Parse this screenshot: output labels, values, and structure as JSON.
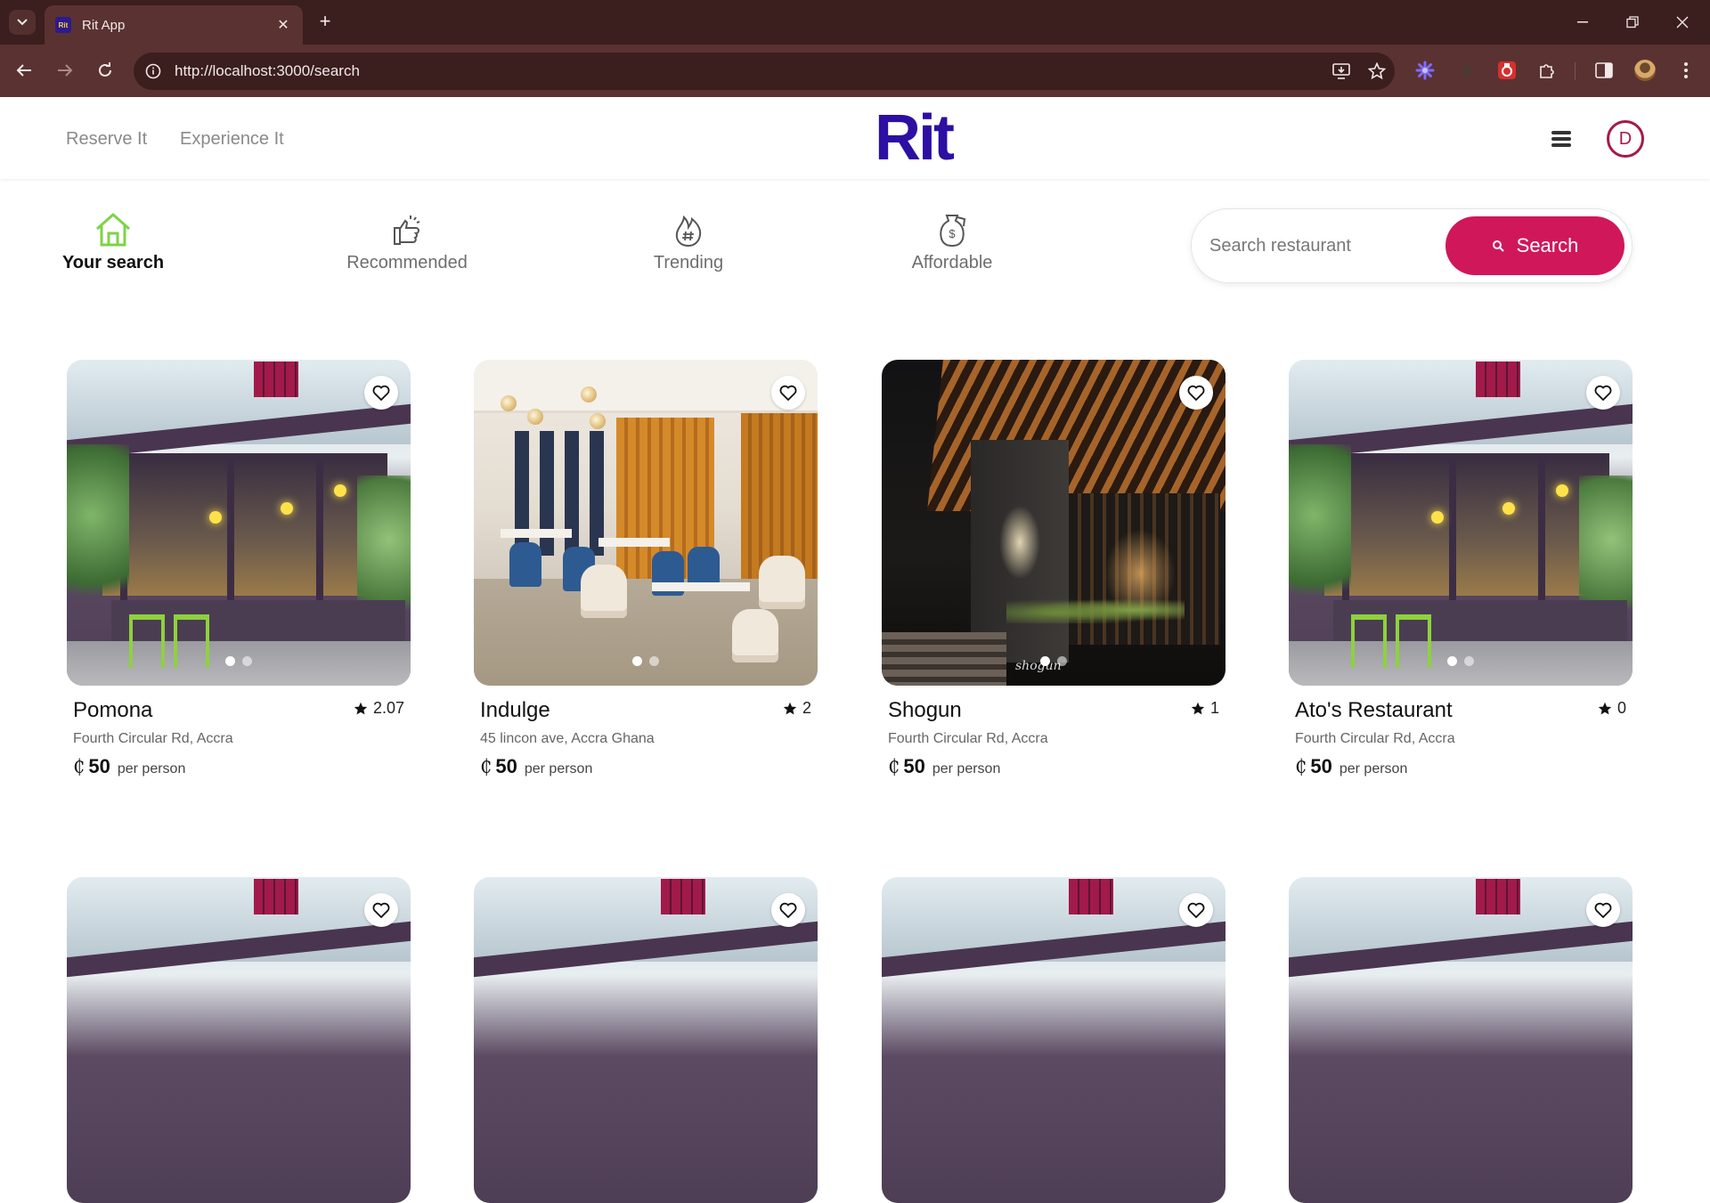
{
  "browser": {
    "tab_title": "Rit App",
    "favicon_text": "Rit",
    "url": "http://localhost:3000/search"
  },
  "header": {
    "nav_links": [
      "Reserve It",
      "Experience It"
    ],
    "logo": "Rit",
    "avatar_initial": "D"
  },
  "categories": [
    {
      "label": "Your search",
      "icon": "home-icon",
      "active": true
    },
    {
      "label": "Recommended",
      "icon": "thumbs-up-icon",
      "active": false
    },
    {
      "label": "Trending",
      "icon": "flame-hashtag-icon",
      "active": false
    },
    {
      "label": "Affordable",
      "icon": "money-tag-icon",
      "active": false
    }
  ],
  "search": {
    "placeholder": "Search restaurant",
    "button_label": "Search"
  },
  "restaurants": [
    {
      "name": "Pomona",
      "rating": "2.07",
      "address": "Fourth Circular Rd, Accra",
      "currency": "₵",
      "price": "50",
      "price_unit": "per person"
    },
    {
      "name": "Indulge",
      "rating": "2",
      "address": "45 lincon ave, Accra Ghana",
      "currency": "₵",
      "price": "50",
      "price_unit": "per person"
    },
    {
      "name": "Shogun",
      "rating": "1",
      "address": "Fourth Circular Rd, Accra",
      "currency": "₵",
      "price": "50",
      "price_unit": "per person"
    },
    {
      "name": "Ato's Restaurant",
      "rating": "0",
      "address": "Fourth Circular Rd, Accra",
      "currency": "₵",
      "price": "50",
      "price_unit": "per person"
    }
  ],
  "image_text": {
    "shogun_signature": "shogun"
  },
  "colors": {
    "brand": "#2d0fa3",
    "accent": "#d0175a",
    "active_icon": "#7ed348"
  }
}
